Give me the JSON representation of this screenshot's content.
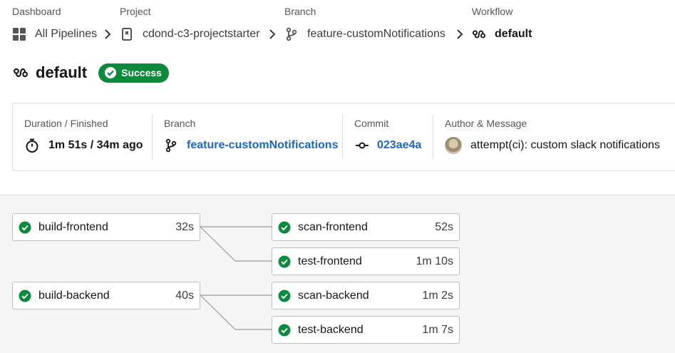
{
  "breadcrumb": {
    "dashboard": {
      "label": "Dashboard",
      "value": "All Pipelines"
    },
    "project": {
      "label": "Project",
      "value": "cdond-c3-projectstarter"
    },
    "branch": {
      "label": "Branch",
      "value": "feature-customNotifications"
    },
    "workflow": {
      "label": "Workflow",
      "value": "default"
    }
  },
  "header": {
    "title": "default",
    "status": "Success",
    "status_color": "#0c8a3b"
  },
  "summary": {
    "duration": {
      "label": "Duration / Finished",
      "value": "1m 51s / 34m ago"
    },
    "branch": {
      "label": "Branch",
      "value": "feature-customNotifications"
    },
    "commit": {
      "label": "Commit",
      "value": "023ae4a"
    },
    "author": {
      "label": "Author & Message",
      "value": "attempt(ci): custom slack notifications"
    }
  },
  "jobs": {
    "build_frontend": {
      "name": "build-frontend",
      "duration": "32s"
    },
    "scan_frontend": {
      "name": "scan-frontend",
      "duration": "52s"
    },
    "test_frontend": {
      "name": "test-frontend",
      "duration": "1m 10s"
    },
    "build_backend": {
      "name": "build-backend",
      "duration": "40s"
    },
    "scan_backend": {
      "name": "scan-backend",
      "duration": "1m 2s"
    },
    "test_backend": {
      "name": "test-backend",
      "duration": "1m 7s"
    }
  },
  "colors": {
    "success": "#0c8a3b",
    "link": "#1a66c2"
  }
}
